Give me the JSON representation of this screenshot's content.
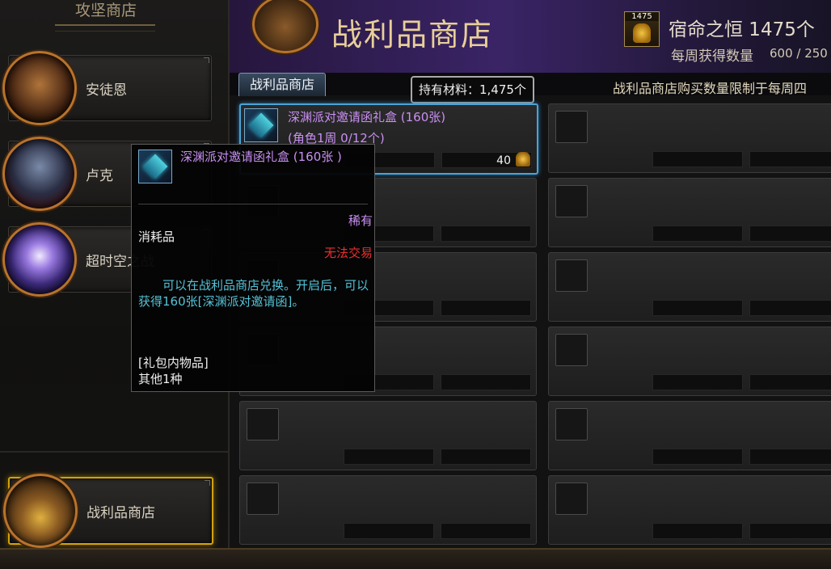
{
  "sidebar": {
    "title": "攻坚商店",
    "items": [
      {
        "label": "安徒恩",
        "icon": "anton-avatar-icon"
      },
      {
        "label": "卢克",
        "icon": "luke-avatar-icon"
      },
      {
        "label": "超时空之战",
        "icon": "super-space-time-avatar-icon"
      }
    ],
    "bottom_item": {
      "label": "战利品商店",
      "icon": "loot-chest-icon"
    }
  },
  "header": {
    "title": "战利品商店",
    "currency": {
      "icon_count": "1475",
      "name_text": "宿命之恒 1475个",
      "weekly_label": "每周获得数量",
      "weekly_value": "600 / 250"
    }
  },
  "tabs": [
    {
      "label": "战利品商店"
    }
  ],
  "held_materials": "持有材料：1,475个",
  "notice": "战利品商店购买数量限制于每周四",
  "items": [
    {
      "name": "深渊派对邀请函礼盒 (160张)",
      "limit": "(角色1周 0/12个)",
      "price": "40"
    }
  ],
  "tooltip": {
    "name": "深渊派对邀请函礼盒 (160张 )",
    "rarity": "稀有",
    "type": "消耗品",
    "trade": "无法交易",
    "description": "可以在战利品商店兑换。开启后，可以获得160张[深渊派对邀请函]。",
    "pack_title": "[礼包内物品]",
    "pack_items": "其他1种"
  },
  "colors": {
    "rare_purple": "#c98ff2",
    "untradeable_red": "#ee2e2e",
    "desc_cyan": "#55c2d6",
    "selection_blue": "#4aa3d6",
    "active_gold": "#d3a20b"
  }
}
